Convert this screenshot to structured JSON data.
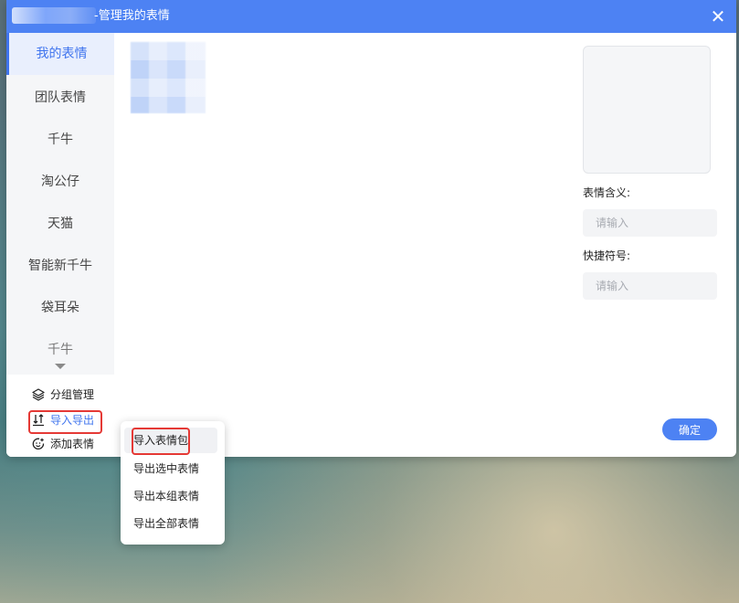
{
  "window": {
    "title": "-管理我的表情"
  },
  "sidebar": {
    "items": [
      {
        "label": "我的表情"
      },
      {
        "label": "团队表情"
      },
      {
        "label": "千牛"
      },
      {
        "label": "淘公仔"
      },
      {
        "label": "天猫"
      },
      {
        "label": "智能新千牛"
      },
      {
        "label": "袋耳朵"
      },
      {
        "label": "千牛"
      }
    ],
    "active_index": 0,
    "bottom": {
      "group_manage": "分组管理",
      "import_export": "导入导出",
      "add_emoji": "添加表情"
    }
  },
  "detail": {
    "meaning_label": "表情含义:",
    "meaning_placeholder": "请输入",
    "shortcut_label": "快捷符号:",
    "shortcut_placeholder": "请输入",
    "confirm": "确定"
  },
  "menu": {
    "items": [
      {
        "label": "导入表情包"
      },
      {
        "label": "导出选中表情"
      },
      {
        "label": "导出本组表情"
      },
      {
        "label": "导出全部表情"
      }
    ]
  },
  "colors": {
    "accent": "#4d82f3",
    "highlight_box": "#e53935"
  }
}
